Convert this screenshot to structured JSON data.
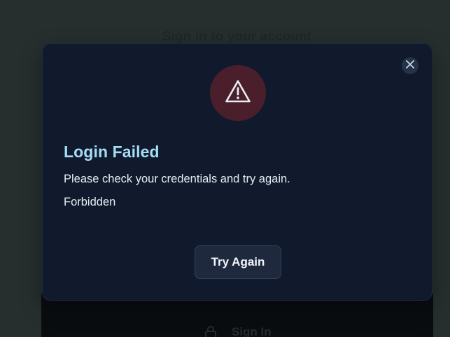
{
  "background": {
    "title": "Sign in to your account",
    "signin_label": "Sign In",
    "signin_icon": "lock-icon"
  },
  "modal": {
    "close_icon": "close-icon",
    "warning_icon": "warning-icon",
    "title": "Login Failed",
    "message": "Please check your credentials and try again.",
    "detail": "Forbidden",
    "retry_label": "Try Again"
  },
  "colors": {
    "modal_bg": "#101a2c",
    "title": "#a7dcf7",
    "warning_bg": "#4a1f2b"
  }
}
